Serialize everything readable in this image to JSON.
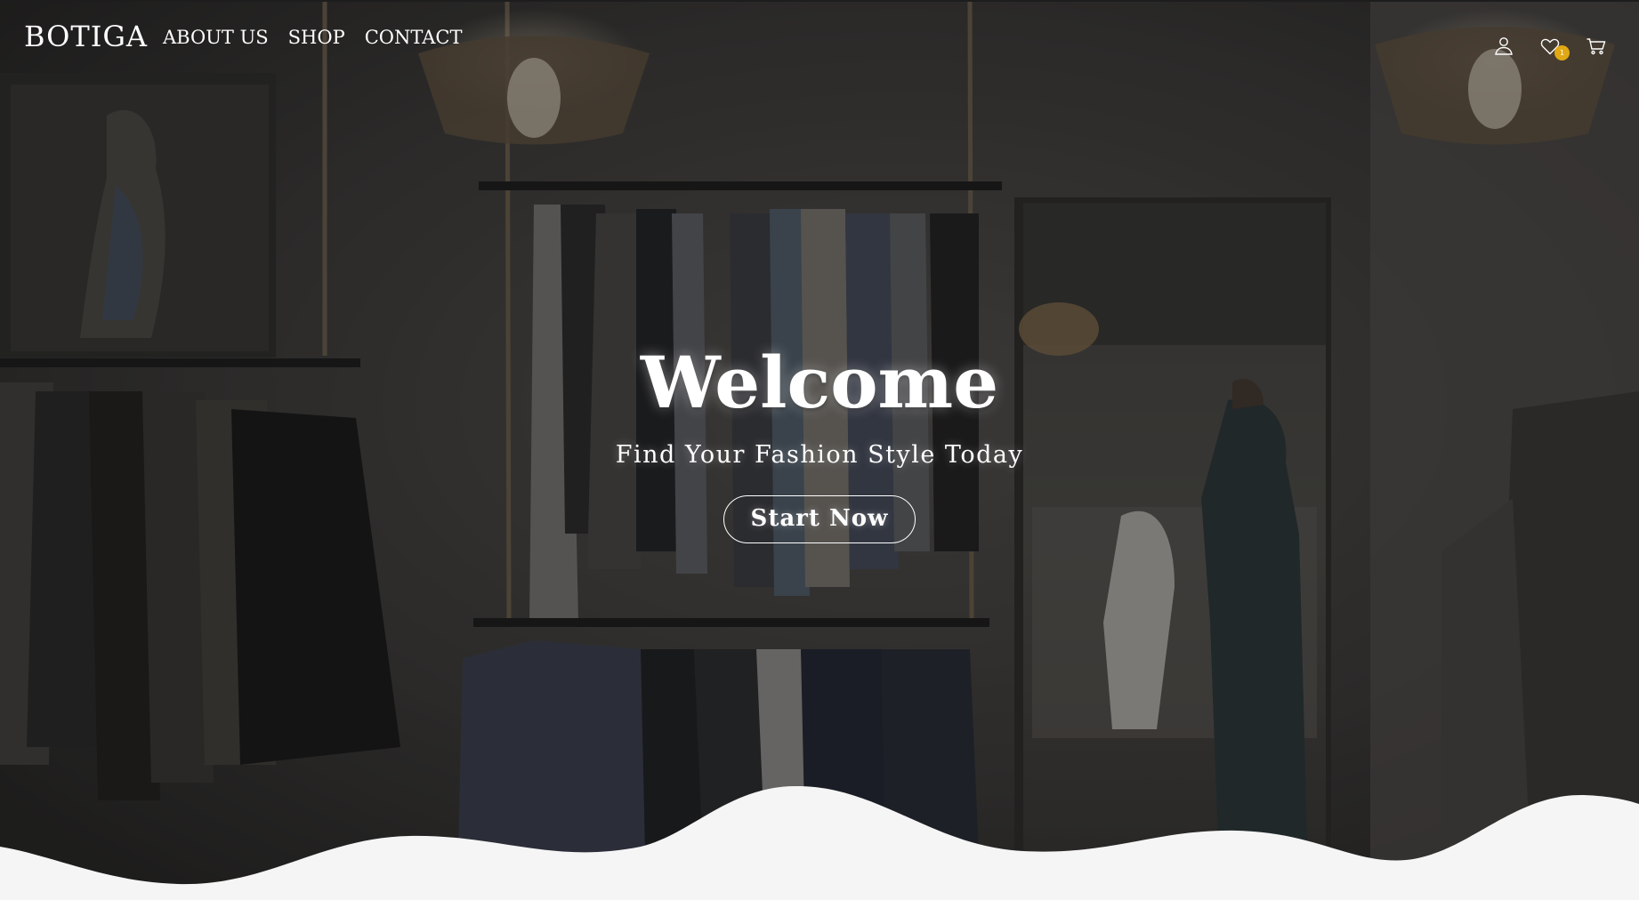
{
  "header": {
    "logo": "BOTIGA",
    "nav": [
      {
        "label": "ABOUT US"
      },
      {
        "label": "SHOP"
      },
      {
        "label": "CONTACT"
      }
    ],
    "icons": {
      "account": "user-icon",
      "wishlist": "heart-icon",
      "wishlist_count": "1",
      "cart": "cart-icon"
    }
  },
  "hero": {
    "title": "Welcome",
    "subtitle": "Find Your Fashion Style Today",
    "cta_label": "Start Now"
  },
  "colors": {
    "badge": "#e0a814",
    "text": "#ffffff",
    "page_bg": "#f5f5f5"
  }
}
